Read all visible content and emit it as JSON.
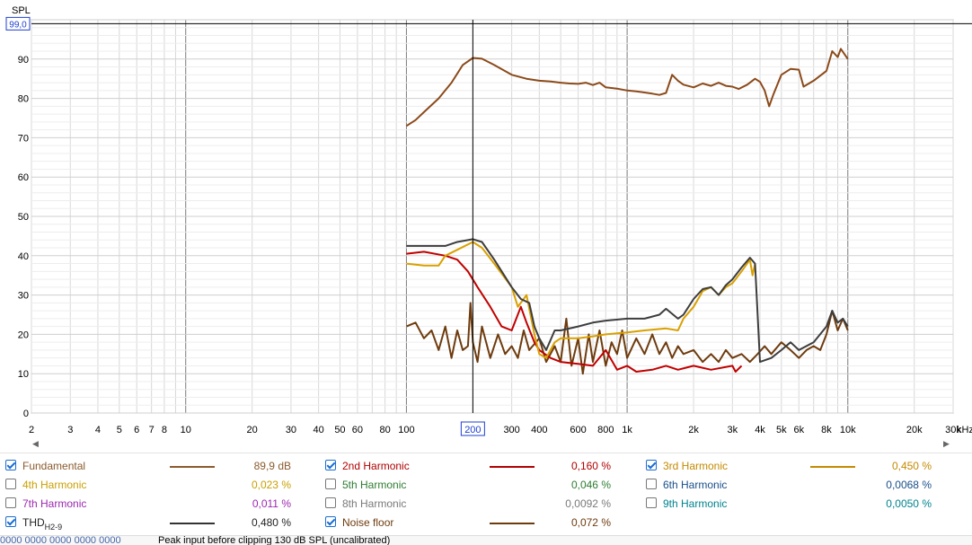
{
  "chart_data": {
    "type": "line",
    "ylabel": "SPL",
    "x_scale": "log",
    "xlim": [
      2,
      30000
    ],
    "ylim": [
      0,
      100
    ],
    "x_unit": "kHz",
    "x_ticks": [
      {
        "v": 2,
        "t": "2"
      },
      {
        "v": 3,
        "t": "3"
      },
      {
        "v": 4,
        "t": "4"
      },
      {
        "v": 5,
        "t": "5"
      },
      {
        "v": 6,
        "t": "6"
      },
      {
        "v": 7,
        "t": "7"
      },
      {
        "v": 8,
        "t": "8"
      },
      {
        "v": 10,
        "t": "10"
      },
      {
        "v": 20,
        "t": "20"
      },
      {
        "v": 30,
        "t": "30"
      },
      {
        "v": 40,
        "t": "40"
      },
      {
        "v": 50,
        "t": "50"
      },
      {
        "v": 60,
        "t": "60"
      },
      {
        "v": 80,
        "t": "80"
      },
      {
        "v": 100,
        "t": "100"
      },
      {
        "v": 200,
        "t": "200"
      },
      {
        "v": 300,
        "t": "300"
      },
      {
        "v": 400,
        "t": "400"
      },
      {
        "v": 600,
        "t": "600"
      },
      {
        "v": 800,
        "t": "800"
      },
      {
        "v": 1000,
        "t": "1k"
      },
      {
        "v": 2000,
        "t": "2k"
      },
      {
        "v": 3000,
        "t": "3k"
      },
      {
        "v": 4000,
        "t": "4k"
      },
      {
        "v": 5000,
        "t": "5k"
      },
      {
        "v": 6000,
        "t": "6k"
      },
      {
        "v": 8000,
        "t": "8k"
      },
      {
        "v": 10000,
        "t": "10k"
      },
      {
        "v": 20000,
        "t": "20k"
      },
      {
        "v": 30000,
        "t": "30k"
      }
    ],
    "y_ticks": [
      {
        "v": 0,
        "t": "0"
      },
      {
        "v": 10,
        "t": "10"
      },
      {
        "v": 20,
        "t": "20"
      },
      {
        "v": 30,
        "t": "30"
      },
      {
        "v": 40,
        "t": "40"
      },
      {
        "v": 50,
        "t": "50"
      },
      {
        "v": 60,
        "t": "60"
      },
      {
        "v": 70,
        "t": "70"
      },
      {
        "v": 80,
        "t": "80"
      },
      {
        "v": 90,
        "t": "90"
      }
    ],
    "cursor": {
      "x": 200,
      "x_label": "200",
      "y": 99.0,
      "y_label": "99,0"
    },
    "grid": true,
    "series": [
      {
        "name": "Fundamental",
        "color": "#8b4a1a",
        "points": [
          [
            100,
            73
          ],
          [
            110,
            74.5
          ],
          [
            120,
            76.5
          ],
          [
            140,
            80
          ],
          [
            160,
            84
          ],
          [
            180,
            88.5
          ],
          [
            200,
            90.3
          ],
          [
            220,
            90.1
          ],
          [
            250,
            88.5
          ],
          [
            300,
            86
          ],
          [
            350,
            85
          ],
          [
            400,
            84.5
          ],
          [
            450,
            84.3
          ],
          [
            500,
            84
          ],
          [
            550,
            83.8
          ],
          [
            600,
            83.7
          ],
          [
            650,
            84
          ],
          [
            700,
            83.4
          ],
          [
            750,
            84
          ],
          [
            800,
            82.8
          ],
          [
            900,
            82.5
          ],
          [
            1000,
            82
          ],
          [
            1100,
            81.8
          ],
          [
            1200,
            81.5
          ],
          [
            1300,
            81.2
          ],
          [
            1400,
            80.9
          ],
          [
            1500,
            81.4
          ],
          [
            1600,
            86
          ],
          [
            1700,
            84.5
          ],
          [
            1800,
            83.5
          ],
          [
            2000,
            82.8
          ],
          [
            2200,
            83.8
          ],
          [
            2400,
            83.2
          ],
          [
            2600,
            84
          ],
          [
            2800,
            83.2
          ],
          [
            3000,
            83
          ],
          [
            3200,
            82.4
          ],
          [
            3500,
            83.5
          ],
          [
            3800,
            85
          ],
          [
            4000,
            84.2
          ],
          [
            4200,
            82
          ],
          [
            4400,
            78
          ],
          [
            4600,
            81
          ],
          [
            5000,
            86
          ],
          [
            5500,
            87.5
          ],
          [
            6000,
            87.3
          ],
          [
            6300,
            83
          ],
          [
            7000,
            84.5
          ],
          [
            8000,
            87
          ],
          [
            8500,
            92
          ],
          [
            9000,
            90.5
          ],
          [
            9300,
            92.6
          ],
          [
            10000,
            90
          ]
        ]
      },
      {
        "name": "2nd Harmonic",
        "color": "#c00000",
        "points": [
          [
            100,
            40.5
          ],
          [
            120,
            41
          ],
          [
            150,
            40
          ],
          [
            170,
            39
          ],
          [
            190,
            36
          ],
          [
            210,
            32
          ],
          [
            240,
            27
          ],
          [
            270,
            22
          ],
          [
            300,
            21
          ],
          [
            330,
            27
          ],
          [
            350,
            23
          ],
          [
            380,
            18
          ],
          [
            400,
            16
          ],
          [
            450,
            14
          ],
          [
            500,
            13
          ],
          [
            600,
            12.5
          ],
          [
            700,
            12
          ],
          [
            800,
            16
          ],
          [
            900,
            11
          ],
          [
            1000,
            12
          ],
          [
            1100,
            10.5
          ],
          [
            1300,
            11
          ],
          [
            1500,
            12
          ],
          [
            1700,
            11
          ],
          [
            2000,
            12
          ],
          [
            2400,
            11
          ],
          [
            3000,
            12
          ],
          [
            3100,
            10.5
          ],
          [
            3300,
            12
          ]
        ]
      },
      {
        "name": "3rd Harmonic",
        "color": "#d9a000",
        "points": [
          [
            100,
            38
          ],
          [
            120,
            37.5
          ],
          [
            140,
            37.5
          ],
          [
            150,
            40
          ],
          [
            170,
            41.5
          ],
          [
            200,
            43.5
          ],
          [
            220,
            42
          ],
          [
            250,
            38
          ],
          [
            300,
            32
          ],
          [
            320,
            27
          ],
          [
            350,
            30
          ],
          [
            380,
            20
          ],
          [
            400,
            15
          ],
          [
            430,
            14
          ],
          [
            470,
            18
          ],
          [
            500,
            19
          ],
          [
            600,
            19
          ],
          [
            700,
            19.5
          ],
          [
            800,
            20
          ],
          [
            1000,
            20.5
          ],
          [
            1200,
            21
          ],
          [
            1500,
            21.5
          ],
          [
            1700,
            21
          ],
          [
            1800,
            24
          ],
          [
            2000,
            27
          ],
          [
            2200,
            31
          ],
          [
            2400,
            32
          ],
          [
            2600,
            30
          ],
          [
            2800,
            32
          ],
          [
            3000,
            33
          ],
          [
            3300,
            36
          ],
          [
            3600,
            39
          ],
          [
            3700,
            35
          ],
          [
            3800,
            38
          ]
        ]
      },
      {
        "name": "THD",
        "color": "#3d3d3d",
        "points": [
          [
            100,
            42.5
          ],
          [
            120,
            42.5
          ],
          [
            150,
            42.5
          ],
          [
            170,
            43.5
          ],
          [
            200,
            44.2
          ],
          [
            220,
            43.5
          ],
          [
            250,
            39
          ],
          [
            300,
            32
          ],
          [
            330,
            29
          ],
          [
            360,
            28
          ],
          [
            380,
            22
          ],
          [
            400,
            19
          ],
          [
            430,
            16
          ],
          [
            470,
            21
          ],
          [
            500,
            21
          ],
          [
            600,
            22
          ],
          [
            700,
            23
          ],
          [
            800,
            23.5
          ],
          [
            1000,
            24
          ],
          [
            1200,
            24
          ],
          [
            1400,
            25
          ],
          [
            1500,
            26.5
          ],
          [
            1700,
            24
          ],
          [
            1800,
            25
          ],
          [
            2000,
            29
          ],
          [
            2200,
            31.5
          ],
          [
            2400,
            32
          ],
          [
            2600,
            30
          ],
          [
            2800,
            32.5
          ],
          [
            3000,
            34
          ],
          [
            3300,
            37
          ],
          [
            3600,
            39.5
          ],
          [
            3800,
            38
          ],
          [
            4000,
            13
          ],
          [
            4500,
            14
          ],
          [
            5000,
            16
          ],
          [
            5500,
            18
          ],
          [
            6000,
            16
          ],
          [
            7000,
            18
          ],
          [
            8000,
            22
          ],
          [
            8500,
            26
          ],
          [
            9000,
            23
          ],
          [
            9500,
            24
          ],
          [
            10000,
            22
          ]
        ]
      },
      {
        "name": "Noise floor",
        "color": "#6e3b0e",
        "points": [
          [
            100,
            22
          ],
          [
            110,
            23
          ],
          [
            120,
            19
          ],
          [
            130,
            21
          ],
          [
            140,
            16
          ],
          [
            150,
            22
          ],
          [
            160,
            14
          ],
          [
            170,
            21
          ],
          [
            180,
            16
          ],
          [
            190,
            17
          ],
          [
            195,
            28
          ],
          [
            200,
            18
          ],
          [
            210,
            13
          ],
          [
            220,
            22
          ],
          [
            240,
            14
          ],
          [
            260,
            20
          ],
          [
            280,
            15
          ],
          [
            300,
            17
          ],
          [
            320,
            14
          ],
          [
            340,
            21
          ],
          [
            360,
            16
          ],
          [
            400,
            19
          ],
          [
            430,
            13
          ],
          [
            470,
            17
          ],
          [
            500,
            13
          ],
          [
            530,
            24
          ],
          [
            560,
            12
          ],
          [
            600,
            19
          ],
          [
            630,
            10
          ],
          [
            670,
            20
          ],
          [
            700,
            13
          ],
          [
            750,
            21
          ],
          [
            800,
            12
          ],
          [
            850,
            18
          ],
          [
            900,
            15
          ],
          [
            950,
            21
          ],
          [
            1000,
            14
          ],
          [
            1100,
            19
          ],
          [
            1200,
            15
          ],
          [
            1300,
            20
          ],
          [
            1400,
            15
          ],
          [
            1500,
            18
          ],
          [
            1600,
            14
          ],
          [
            1700,
            17
          ],
          [
            1800,
            15
          ],
          [
            2000,
            16
          ],
          [
            2200,
            13
          ],
          [
            2400,
            15
          ],
          [
            2600,
            13
          ],
          [
            2800,
            16
          ],
          [
            3000,
            14
          ],
          [
            3300,
            15
          ],
          [
            3600,
            13
          ],
          [
            3900,
            15
          ],
          [
            4200,
            17
          ],
          [
            4500,
            15
          ],
          [
            5000,
            18
          ],
          [
            5500,
            16
          ],
          [
            6000,
            14
          ],
          [
            6500,
            16
          ],
          [
            7000,
            17
          ],
          [
            7500,
            16
          ],
          [
            8000,
            20
          ],
          [
            8500,
            26
          ],
          [
            9000,
            21
          ],
          [
            9500,
            24
          ],
          [
            10000,
            21
          ]
        ]
      }
    ]
  },
  "legend": [
    {
      "name": "Fundamental",
      "sub": "",
      "checked": true,
      "swatch": true,
      "value": "89,9 dB",
      "color": "#8b5a2b",
      "value_color": "#8b5a2b"
    },
    {
      "name": "2nd Harmonic",
      "sub": "",
      "checked": true,
      "swatch": true,
      "value": "0,160 %",
      "color": "#b00000",
      "value_color": "#b00000"
    },
    {
      "name": "3rd Harmonic",
      "sub": "",
      "checked": true,
      "swatch": true,
      "value": "0,450 %",
      "color": "#c48a00",
      "value_color": "#c48a00"
    },
    {
      "name": "4th Harmonic",
      "sub": "",
      "checked": false,
      "swatch": false,
      "value": "0,023 %",
      "color": "#c9a000",
      "value_color": "#c9a000"
    },
    {
      "name": "5th Harmonic",
      "sub": "",
      "checked": false,
      "swatch": false,
      "value": "0,046 %",
      "color": "#2e7d32",
      "value_color": "#2e7d32"
    },
    {
      "name": "6th Harmonic",
      "sub": "",
      "checked": false,
      "swatch": false,
      "value": "0,0068 %",
      "color": "#1a4f8a",
      "value_color": "#1a4f8a"
    },
    {
      "name": "7th Harmonic",
      "sub": "",
      "checked": false,
      "swatch": false,
      "value": "0,011 %",
      "color": "#9c27b0",
      "value_color": "#9c27b0"
    },
    {
      "name": "8th Harmonic",
      "sub": "",
      "checked": false,
      "swatch": false,
      "value": "0,0092 %",
      "color": "#7a7a7a",
      "value_color": "#7a7a7a"
    },
    {
      "name": "9th Harmonic",
      "sub": "",
      "checked": false,
      "swatch": false,
      "value": "0,0050 %",
      "color": "#00838f",
      "value_color": "#00838f"
    },
    {
      "name": "THD",
      "sub": "H2-9",
      "checked": true,
      "swatch": true,
      "value": "0,480 %",
      "color": "#333333",
      "value_color": "#222222"
    },
    {
      "name": "Noise floor",
      "sub": "",
      "checked": true,
      "swatch": true,
      "value": "0,072 %",
      "color": "#6e3b0e",
      "value_color": "#6e3b0e"
    }
  ],
  "status": {
    "left": "0000 0000 0000 0000 0000",
    "message": "Peak input before clipping 130 dB SPL (uncalibrated)"
  }
}
